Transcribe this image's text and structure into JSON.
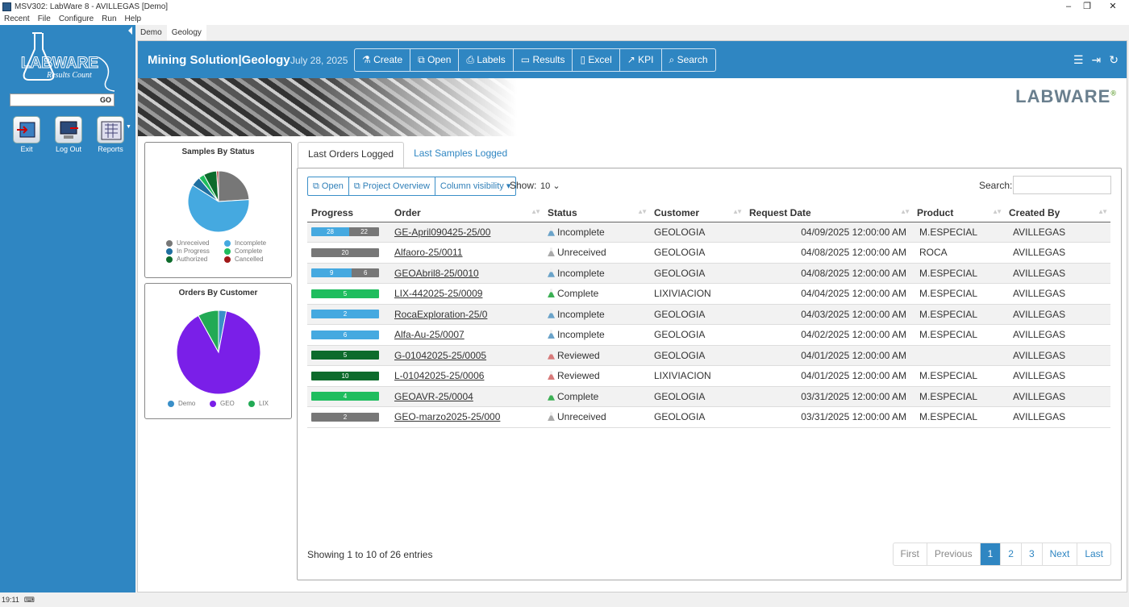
{
  "window": {
    "title": "MSV302: LabWare 8 - AVILLEGAS [Demo]"
  },
  "menu": [
    "Recent",
    "File",
    "Configure",
    "Run",
    "Help"
  ],
  "sidebar": {
    "logo_text": "LABWARE",
    "logo_sub": "Results Count",
    "go_label": "GO",
    "tools": [
      {
        "label": "Exit",
        "icon": "exit-icon"
      },
      {
        "label": "Log Out",
        "icon": "logout-icon"
      },
      {
        "label": "Reports",
        "icon": "reports-icon"
      }
    ]
  },
  "tabs": [
    "Demo",
    "Geology"
  ],
  "header": {
    "title": "Mining Solution|Geology",
    "date": "July 28, 2025",
    "buttons": [
      "Create",
      "Open",
      "Labels",
      "Results",
      "Excel",
      "KPI",
      "Search"
    ]
  },
  "brand": {
    "logo": "LABWARE",
    "reg": "®"
  },
  "samples_panel": {
    "title": "Samples By Status",
    "legend": [
      {
        "label": "Unreceived",
        "color": "#777777"
      },
      {
        "label": "Incomplete",
        "color": "#45a9e0"
      },
      {
        "label": "In Progress",
        "color": "#1f6fa0"
      },
      {
        "label": "Complete",
        "color": "#1fbd5e"
      },
      {
        "label": "Authorized",
        "color": "#0d6b2c"
      },
      {
        "label": "Cancelled",
        "color": "#a01818"
      }
    ],
    "chart_data": {
      "type": "pie",
      "categories": [
        "Unreceived",
        "Incomplete",
        "In Progress",
        "Complete",
        "Authorized",
        "Cancelled"
      ],
      "values": [
        24,
        60,
        5,
        3,
        7,
        1
      ]
    }
  },
  "orders_panel": {
    "title": "Orders By Customer",
    "legend": [
      {
        "label": "Demo",
        "color": "#3a8fc8"
      },
      {
        "label": "GEO",
        "color": "#7a1fe8"
      },
      {
        "label": "LIX",
        "color": "#22aa55"
      }
    ],
    "chart_data": {
      "type": "pie",
      "categories": [
        "Demo",
        "GEO",
        "LIX"
      ],
      "values": [
        3,
        89,
        8
      ]
    }
  },
  "list_tabs": [
    "Last Orders Logged",
    "Last Samples Logged"
  ],
  "table_buttons": [
    "Open",
    "Project Overview",
    "Column visibility"
  ],
  "show_label": "Show:",
  "show_value": "10",
  "search_label": "Search:",
  "columns": [
    "Progress",
    "Order",
    "Status",
    "Customer",
    "Request Date",
    "Product",
    "Created By"
  ],
  "rows": [
    {
      "bar": [
        {
          "v": 28,
          "c": "#45a9e0"
        },
        {
          "v": 22,
          "c": "#777777"
        }
      ],
      "order": "GE-April090425-25/00",
      "status": "Incomplete",
      "sc": "#6aa3c9",
      "customer": "GEOLOGIA",
      "date": "04/09/2025 12:00:00 AM",
      "product": "M.ESPECIAL",
      "by": "AVILLEGAS"
    },
    {
      "bar": [
        {
          "v": 20,
          "c": "#777777"
        }
      ],
      "order": "Alfaoro-25/0011",
      "status": "Unreceived",
      "sc": "#aaaaaa",
      "customer": "GEOLOGIA",
      "date": "04/08/2025 12:00:00 AM",
      "product": "ROCA",
      "by": "AVILLEGAS"
    },
    {
      "bar": [
        {
          "v": 9,
          "c": "#45a9e0"
        },
        {
          "v": 6,
          "c": "#777777"
        }
      ],
      "order": "GEOAbril8-25/0010",
      "status": "Incomplete",
      "sc": "#6aa3c9",
      "customer": "GEOLOGIA",
      "date": "04/08/2025 12:00:00 AM",
      "product": "M.ESPECIAL",
      "by": "AVILLEGAS"
    },
    {
      "bar": [
        {
          "v": 5,
          "c": "#1fbd5e"
        }
      ],
      "order": "LIX-442025-25/0009",
      "status": "Complete",
      "sc": "#3cb054",
      "customer": "LIXIVIACION",
      "date": "04/04/2025 12:00:00 AM",
      "product": "M.ESPECIAL",
      "by": "AVILLEGAS"
    },
    {
      "bar": [
        {
          "v": 2,
          "c": "#45a9e0"
        }
      ],
      "order": "RocaExploration-25/0",
      "status": "Incomplete",
      "sc": "#6aa3c9",
      "customer": "GEOLOGIA",
      "date": "04/03/2025 12:00:00 AM",
      "product": "M.ESPECIAL",
      "by": "AVILLEGAS"
    },
    {
      "bar": [
        {
          "v": 6,
          "c": "#45a9e0"
        }
      ],
      "order": "Alfa-Au-25/0007",
      "status": "Incomplete",
      "sc": "#6aa3c9",
      "customer": "GEOLOGIA",
      "date": "04/02/2025 12:00:00 AM",
      "product": "M.ESPECIAL",
      "by": "AVILLEGAS"
    },
    {
      "bar": [
        {
          "v": 5,
          "c": "#0d6b2c"
        }
      ],
      "order": "G-01042025-25/0005",
      "status": "Reviewed",
      "sc": "#d87a7a",
      "customer": "GEOLOGIA",
      "date": "04/01/2025 12:00:00 AM",
      "product": "",
      "by": "AVILLEGAS"
    },
    {
      "bar": [
        {
          "v": 10,
          "c": "#0d6b2c"
        }
      ],
      "order": "L-01042025-25/0006",
      "status": "Reviewed",
      "sc": "#d87a7a",
      "customer": "LIXIVIACION",
      "date": "04/01/2025 12:00:00 AM",
      "product": "M.ESPECIAL",
      "by": "AVILLEGAS"
    },
    {
      "bar": [
        {
          "v": 4,
          "c": "#1fbd5e"
        }
      ],
      "order": "GEOAVR-25/0004",
      "status": "Complete",
      "sc": "#3cb054",
      "customer": "GEOLOGIA",
      "date": "03/31/2025 12:00:00 AM",
      "product": "M.ESPECIAL",
      "by": "AVILLEGAS"
    },
    {
      "bar": [
        {
          "v": 2,
          "c": "#777777"
        }
      ],
      "order": "GEO-marzo2025-25/000",
      "status": "Unreceived",
      "sc": "#aaaaaa",
      "customer": "GEOLOGIA",
      "date": "03/31/2025 12:00:00 AM",
      "product": "M.ESPECIAL",
      "by": "AVILLEGAS"
    }
  ],
  "info": "Showing 1 to 10 of 26 entries",
  "pager": [
    "First",
    "Previous",
    "1",
    "2",
    "3",
    "Next",
    "Last"
  ],
  "pager_current": "1",
  "status_time": "19:11"
}
